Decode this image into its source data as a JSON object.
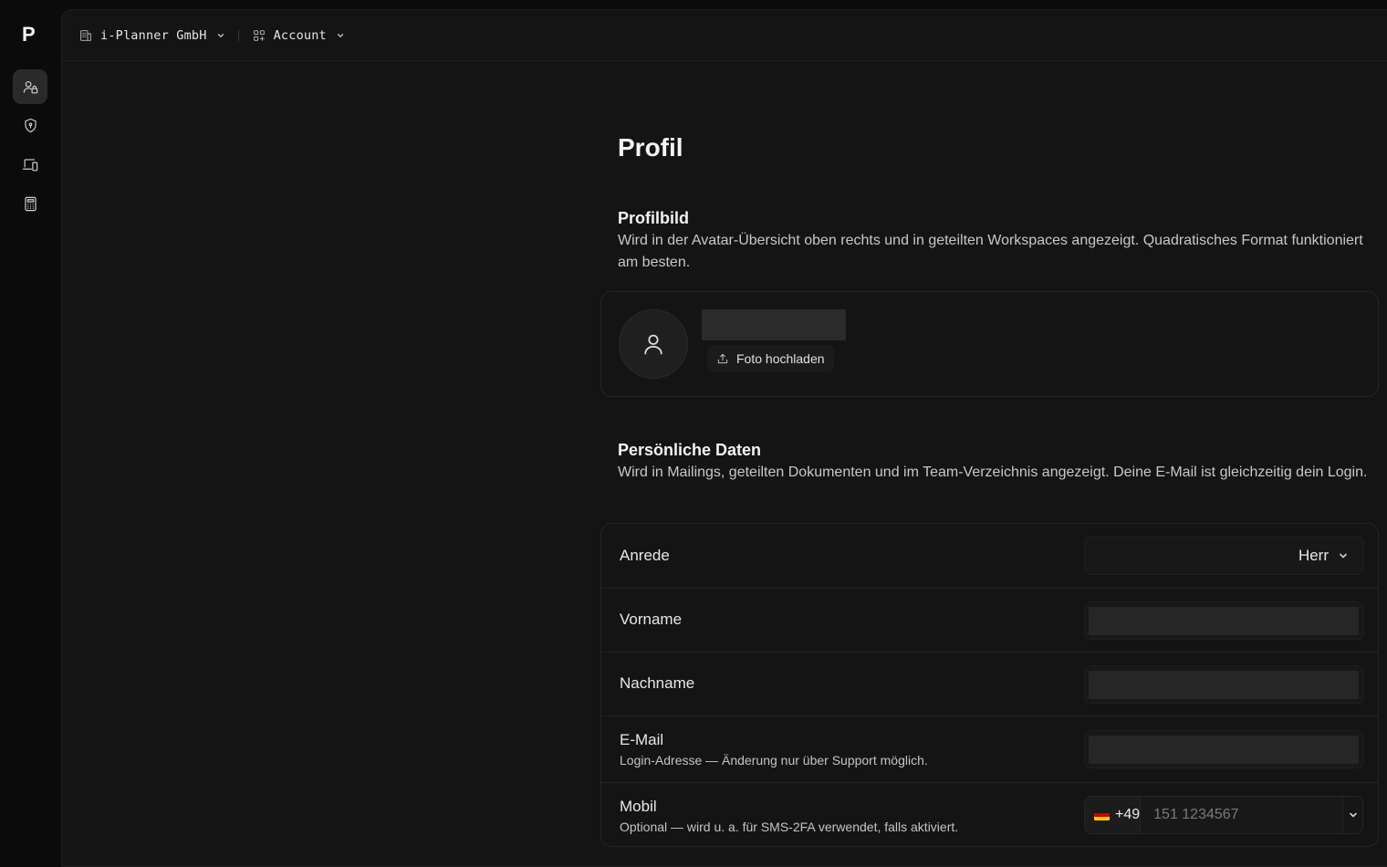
{
  "app": {
    "logo_text": "P"
  },
  "rail": [
    {
      "name": "account-users-icon",
      "active": true
    },
    {
      "name": "shield-icon",
      "active": false
    },
    {
      "name": "devices-icon",
      "active": false
    },
    {
      "name": "calculator-icon",
      "active": false
    }
  ],
  "topbar": {
    "org_label": "i-Planner GmbH",
    "section_label": "Account"
  },
  "page": {
    "title": "Profil"
  },
  "profile_picture": {
    "title": "Profilbild",
    "description": "Wird in der Avatar-Übersicht oben rechts und in geteilten Workspaces angezeigt. Quadratisches Format funktioniert am besten.",
    "upload_label": "Foto hochladen"
  },
  "personal": {
    "title": "Persönliche Daten",
    "description": "Wird in Mailings, geteilten Dokumenten und im Team-Verzeichnis angezeigt. Deine E-Mail ist gleichzeitig dein Login.",
    "salutation": {
      "label": "Anrede",
      "value": "Herr"
    },
    "firstname": {
      "label": "Vorname",
      "value": ""
    },
    "lastname": {
      "label": "Nachname",
      "value": ""
    },
    "email": {
      "label": "E-Mail",
      "hint": "Login-Adresse — Änderung nur über Support möglich.",
      "value": ""
    },
    "mobile": {
      "label": "Mobil",
      "hint": "Optional — wird u. a. für SMS-2FA verwendet, falls aktiviert.",
      "country_code": "+49",
      "placeholder": "151 1234567",
      "value": ""
    }
  },
  "colors": {
    "accent": "#e8e8e8",
    "background": "#0b0b0b",
    "panel": "#141414"
  }
}
